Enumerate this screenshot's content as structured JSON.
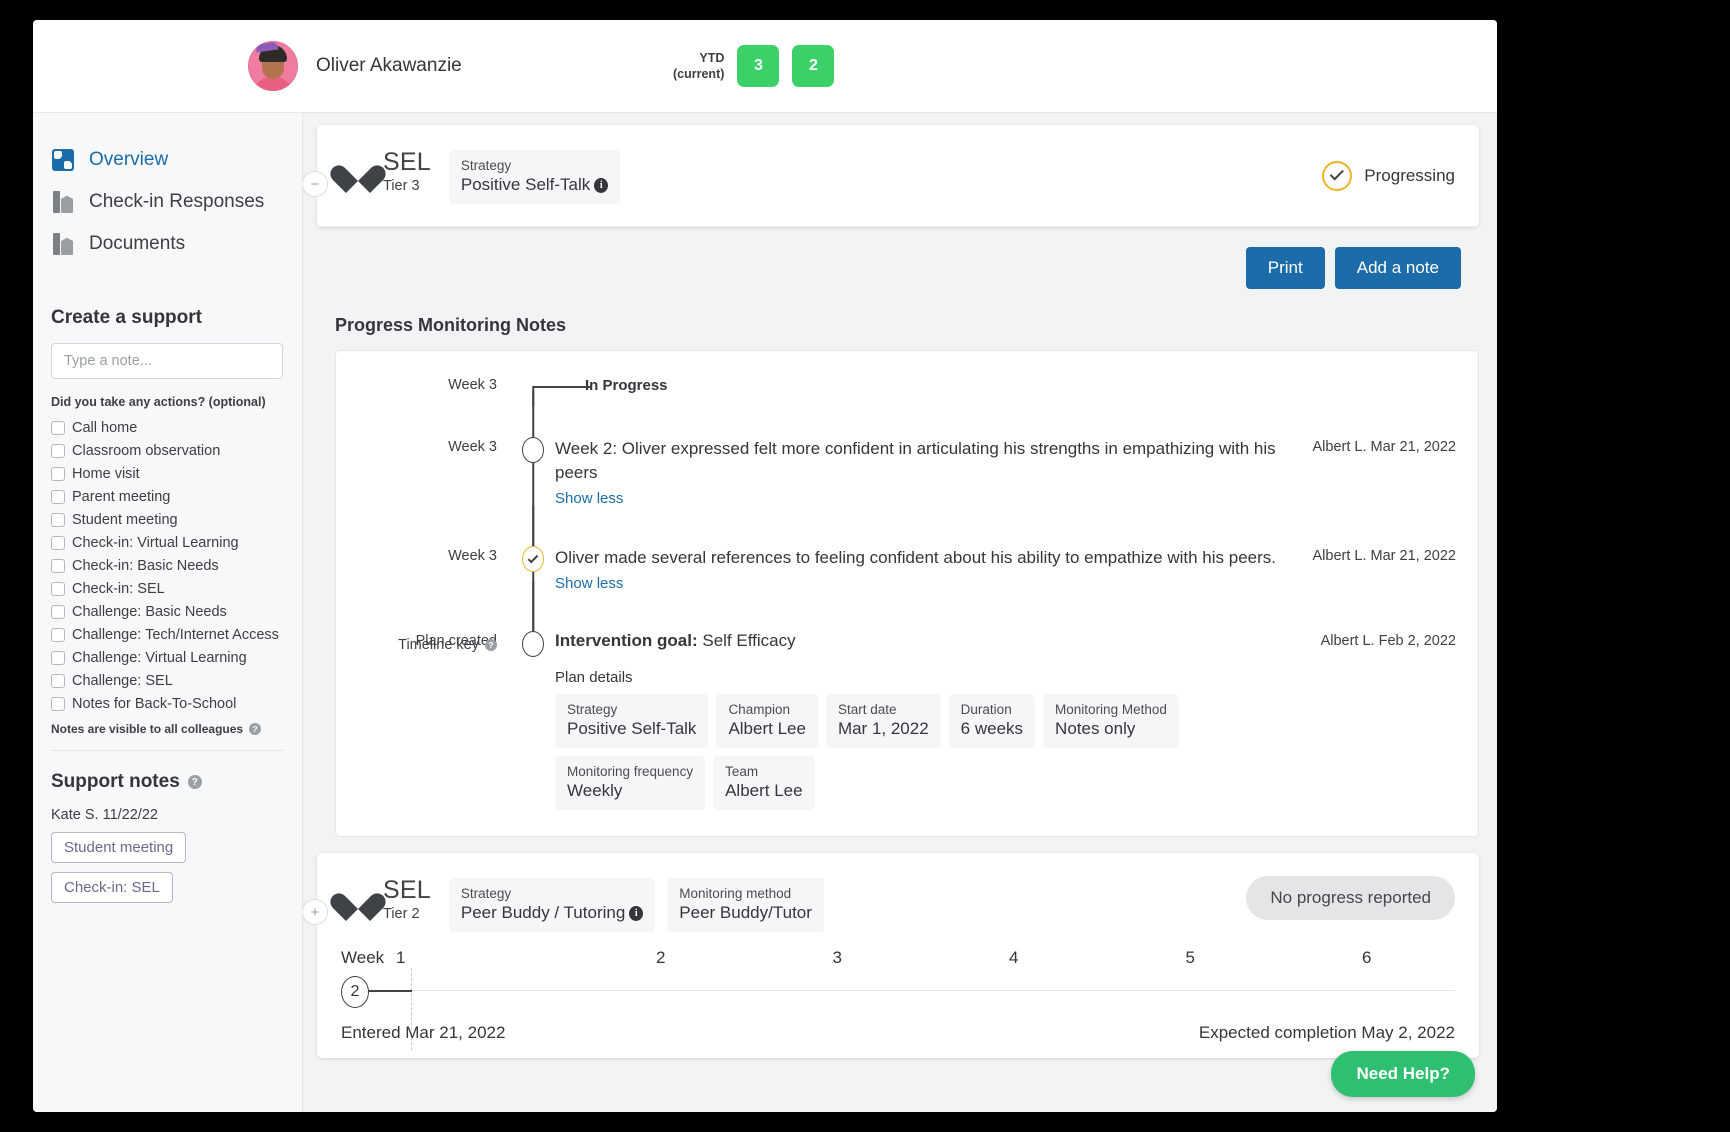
{
  "header": {
    "student_name": "Oliver Akawanzie",
    "ytd_label_line1": "YTD",
    "ytd_label_line2": "(current)",
    "ytd_chip_1": "3",
    "ytd_chip_2": "2"
  },
  "sidebar": {
    "nav": [
      {
        "label": "Overview",
        "icon": "puzzle-icon",
        "active": true
      },
      {
        "label": "Check-in Responses",
        "icon": "book-icon",
        "active": false
      },
      {
        "label": "Documents",
        "icon": "book-icon",
        "active": false
      }
    ],
    "create_support_title": "Create a support",
    "note_placeholder": "Type a note...",
    "actions_question": "Did you take any actions? (optional)",
    "action_options": [
      "Call home",
      "Classroom observation",
      "Home visit",
      "Parent meeting",
      "Student meeting",
      "Check-in: Virtual Learning",
      "Check-in: Basic Needs",
      "Check-in: SEL",
      "Challenge: Basic Needs",
      "Challenge: Tech/Internet Access",
      "Challenge: Virtual Learning",
      "Challenge: SEL",
      "Notes for Back-To-School"
    ],
    "visibility_note": "Notes are visible to all colleagues",
    "support_notes_title": "Support notes",
    "support_note_author": "Kate S. 11/22/22",
    "support_note_tags": [
      "Student meeting",
      "Check-in: SEL"
    ]
  },
  "card1": {
    "collapse_symbol": "−",
    "domain": "SEL",
    "tier": "Tier 3",
    "strategy_label": "Strategy",
    "strategy_value": "Positive Self-Talk",
    "status_text": "Progressing",
    "print_label": "Print",
    "add_note_label": "Add a note",
    "pm_title": "Progress Monitoring Notes",
    "timeline": [
      {
        "week": "Week 3",
        "kind": "header",
        "text": "In Progress",
        "meta": ""
      },
      {
        "week": "Week 3",
        "kind": "note",
        "text": "Week 2: Oliver expressed felt more confident in articulating his strengths in empathizing with his peers",
        "showless": "Show less",
        "meta": "Albert L. Mar 21, 2022"
      },
      {
        "week": "Week 3",
        "kind": "note-checked",
        "text": "Oliver made several references to feeling confident about his ability to empathize with his peers.",
        "showless": "Show less",
        "meta": "Albert L. Mar 21, 2022"
      },
      {
        "week": "Plan created",
        "kind": "plan",
        "goal_label": "Intervention goal:",
        "goal_value": "Self Efficacy",
        "meta": "Albert L. Feb 2, 2022"
      }
    ],
    "timeline_key_label": "Timeline key",
    "plan_details_label": "Plan details",
    "plan_details": [
      {
        "label": "Strategy",
        "value": "Positive Self-Talk"
      },
      {
        "label": "Champion",
        "value": "Albert Lee"
      },
      {
        "label": "Start date",
        "value": "Mar 1, 2022"
      },
      {
        "label": "Duration",
        "value": "6 weeks"
      },
      {
        "label": "Monitoring Method",
        "value": "Notes only"
      },
      {
        "label": "Monitoring frequency",
        "value": "Weekly"
      },
      {
        "label": "Team",
        "value": "Albert Lee"
      }
    ]
  },
  "card2": {
    "expand_symbol": "+",
    "domain": "SEL",
    "tier": "Tier 2",
    "strategy_label": "Strategy",
    "strategy_value": "Peer Buddy / Tutoring",
    "monitoring_label": "Monitoring method",
    "monitoring_value": "Peer Buddy/Tutor",
    "status_badge": "No progress reported",
    "week_word": "Week",
    "week_ticks": [
      "1",
      "2",
      "3",
      "4",
      "5",
      "6"
    ],
    "current_week_bubble": "2",
    "entered_text": "Entered Mar 21, 2022",
    "expected_text": "Expected completion May 2, 2022"
  },
  "help": {
    "label": "Need Help?"
  },
  "colors": {
    "accent_blue": "#1b6ca8",
    "green": "#3bd168",
    "gold": "#f0b429",
    "help_green": "#2fbf71"
  }
}
